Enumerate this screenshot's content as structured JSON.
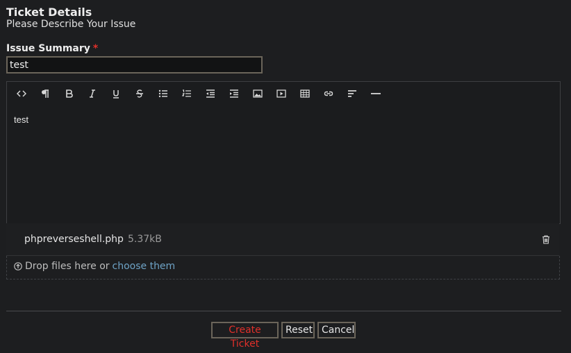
{
  "header": {
    "title": "Ticket Details",
    "subtitle": "Please Describe Your Issue"
  },
  "summary": {
    "label": "Issue Summary",
    "required_mark": "*",
    "value": "test"
  },
  "editor": {
    "toolbar": [
      "code-view-icon",
      "paragraph-icon",
      "bold-icon",
      "italic-icon",
      "underline-icon",
      "strikethrough-icon",
      "bulleted-list-icon",
      "numbered-list-icon",
      "outdent-icon",
      "indent-icon",
      "image-icon",
      "video-icon",
      "table-icon",
      "link-icon",
      "align-icon",
      "horizontal-rule-icon"
    ],
    "body": "test"
  },
  "attachment": {
    "name": "phpreverseshell.php",
    "size": "5.37kB"
  },
  "dropzone": {
    "text": "Drop files here or",
    "link": "choose them"
  },
  "actions": {
    "create": "Create Ticket",
    "reset": "Reset",
    "cancel": "Cancel"
  },
  "colors": {
    "background": "#1d1e20",
    "required": "#e0302a",
    "link": "#6ea3c6",
    "border": "#6b655a"
  }
}
